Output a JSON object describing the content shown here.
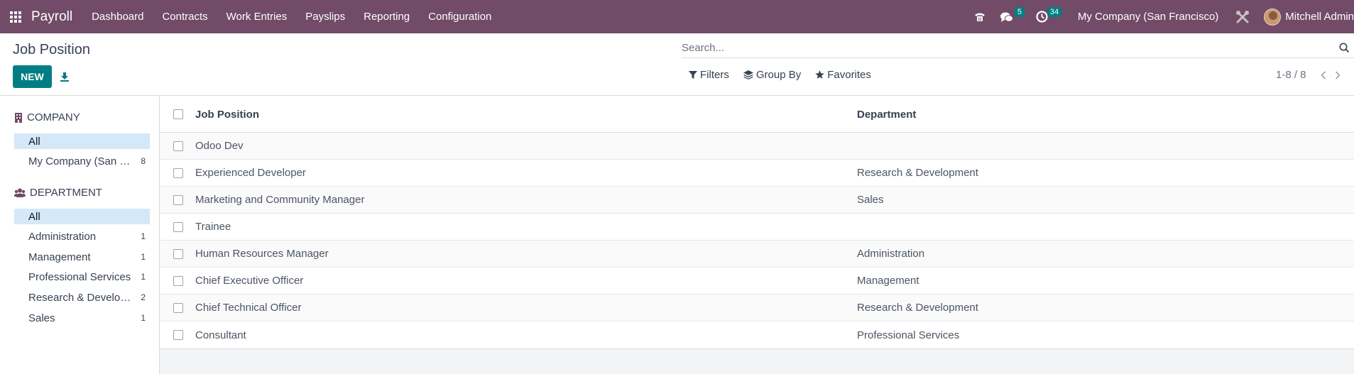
{
  "navbar": {
    "app_name": "Payroll",
    "menu": [
      "Dashboard",
      "Contracts",
      "Work Entries",
      "Payslips",
      "Reporting",
      "Configuration"
    ],
    "messages_count": "5",
    "activities_count": "34",
    "company": "My Company (San Francisco)",
    "user": "Mitchell Admin"
  },
  "control": {
    "title": "Job Position",
    "new_label": "NEW",
    "search_placeholder": "Search...",
    "filters_label": "Filters",
    "groupby_label": "Group By",
    "favorites_label": "Favorites",
    "pager_value": "1-8 / 8"
  },
  "sidebar": {
    "company_header": "COMPANY",
    "company_items": [
      {
        "label": "All",
        "count": ""
      },
      {
        "label": "My Company (San Fr...",
        "count": "8"
      }
    ],
    "department_header": "DEPARTMENT",
    "department_items": [
      {
        "label": "All",
        "count": ""
      },
      {
        "label": "Administration",
        "count": "1"
      },
      {
        "label": "Management",
        "count": "1"
      },
      {
        "label": "Professional Services",
        "count": "1"
      },
      {
        "label": "Research & Develop...",
        "count": "2"
      },
      {
        "label": "Sales",
        "count": "1"
      }
    ]
  },
  "table": {
    "columns": [
      "Job Position",
      "Department"
    ],
    "rows": [
      {
        "job": "Odoo Dev",
        "department": ""
      },
      {
        "job": "Experienced Developer",
        "department": "Research & Development"
      },
      {
        "job": "Marketing and Community Manager",
        "department": "Sales"
      },
      {
        "job": "Trainee",
        "department": ""
      },
      {
        "job": "Human Resources Manager",
        "department": "Administration"
      },
      {
        "job": "Chief Executive Officer",
        "department": "Management"
      },
      {
        "job": "Chief Technical Officer",
        "department": "Research & Development"
      },
      {
        "job": "Consultant",
        "department": "Professional Services"
      }
    ]
  },
  "colors": {
    "navbar": "#714b67",
    "primary": "#017e84",
    "active_filter": "#d4e8f8"
  }
}
